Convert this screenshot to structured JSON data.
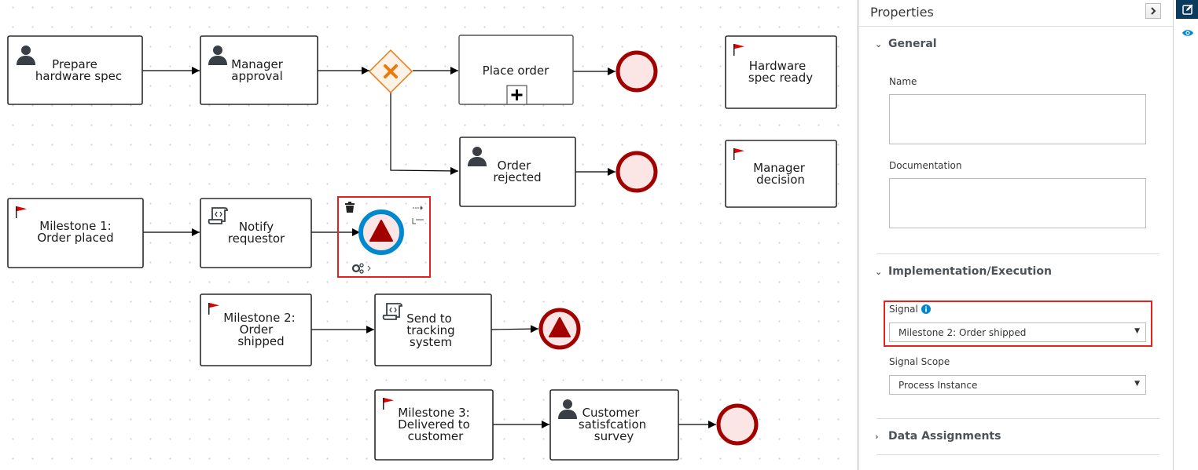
{
  "canvas": {
    "tasks": {
      "prepare_hw_spec": {
        "line1": "Prepare",
        "line2": "hardware spec",
        "type": "user-task"
      },
      "manager_approval": {
        "line1": "Manager",
        "line2": "approval",
        "type": "user-task"
      },
      "place_order": {
        "line1": "Place order",
        "type": "sub-process"
      },
      "order_rejected": {
        "line1": "Order",
        "line2": "rejected",
        "type": "user-task"
      },
      "hw_spec_ready": {
        "line1": "Hardware",
        "line2": "spec ready",
        "type": "milestone"
      },
      "manager_decision": {
        "line1": "Manager",
        "line2": "decision",
        "type": "milestone"
      },
      "milestone1": {
        "line1": "Milestone 1:",
        "line2": "Order placed",
        "type": "milestone"
      },
      "notify_requestor": {
        "line1": "Notify",
        "line2": "requestor",
        "type": "script-task"
      },
      "milestone2": {
        "line1": "Milestone 2:",
        "line2": "Order",
        "line3": "shipped",
        "type": "milestone"
      },
      "send_tracking": {
        "line1": "Send to",
        "line2": "tracking",
        "line3": "system",
        "type": "script-task"
      },
      "milestone3": {
        "line1": "Milestone 3:",
        "line2": "Delivered to",
        "line3": "customer",
        "type": "milestone"
      },
      "customer_survey": {
        "line1": "Customer",
        "line2": "satisfcation",
        "line3": "survey",
        "type": "user-task"
      }
    },
    "colors": {
      "end_event_stroke": "#a30000",
      "end_event_fill": "#fbe5e5",
      "gateway_stroke": "#ec7a08",
      "gateway_fill": "#fdf2e5",
      "selected_stroke": "#0088ce",
      "selection_box": "#e8201c",
      "milestone_flag": "#e00000"
    }
  },
  "panel": {
    "title": "Properties",
    "sections": {
      "general": {
        "label": "General",
        "expanded": true
      },
      "implementation": {
        "label": "Implementation/Execution",
        "expanded": true
      },
      "data_assignments": {
        "label": "Data Assignments",
        "expanded": false
      }
    },
    "fields": {
      "name": {
        "label": "Name",
        "value": ""
      },
      "documentation": {
        "label": "Documentation",
        "value": ""
      },
      "signal": {
        "label": "Signal",
        "value": "Milestone 2: Order shipped"
      },
      "signal_scope": {
        "label": "Signal Scope",
        "value": "Process Instance"
      }
    }
  },
  "rail": {
    "items": [
      {
        "icon": "edit-icon",
        "active": true
      },
      {
        "icon": "eye-icon",
        "active": false
      }
    ]
  }
}
